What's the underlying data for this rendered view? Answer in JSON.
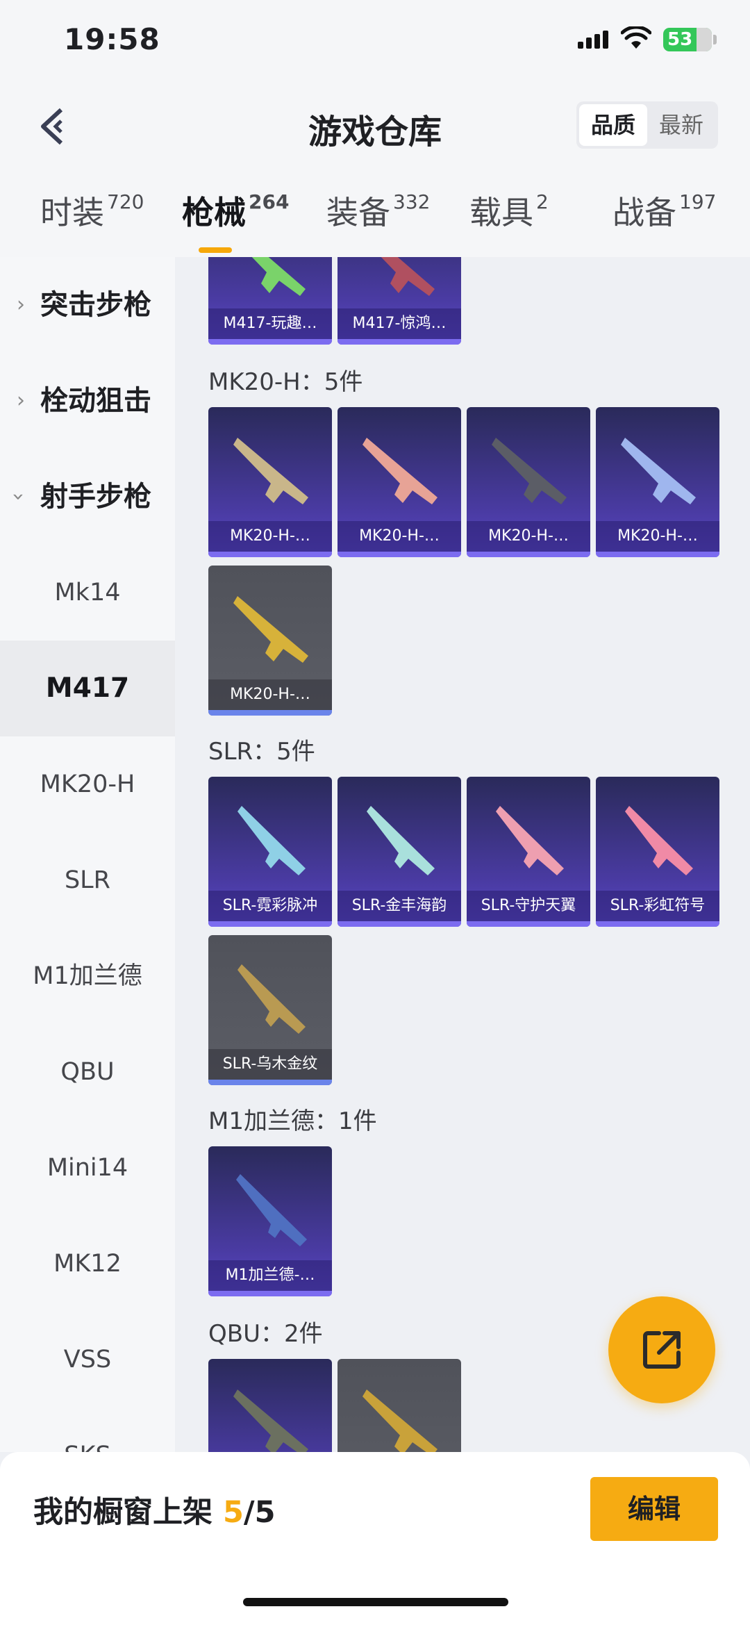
{
  "status": {
    "time": "19:58",
    "battery": "53"
  },
  "header": {
    "title": "游戏仓库",
    "sort_options": [
      {
        "label": "品质",
        "active": true
      },
      {
        "label": "最新",
        "active": false
      }
    ]
  },
  "tabs": [
    {
      "label": "时装",
      "count": "720"
    },
    {
      "label": "枪械",
      "count": "264",
      "active": true
    },
    {
      "label": "装备",
      "count": "332"
    },
    {
      "label": "载具",
      "count": "2"
    },
    {
      "label": "战备",
      "count": "197"
    }
  ],
  "sidebar": {
    "categories": [
      {
        "label": "突击步枪",
        "expanded": false
      },
      {
        "label": "栓动狙击",
        "expanded": false
      },
      {
        "label": "射手步枪",
        "expanded": true
      }
    ],
    "subitems": [
      {
        "label": "Mk14"
      },
      {
        "label": "M417",
        "active": true
      },
      {
        "label": "MK20-H"
      },
      {
        "label": "SLR"
      },
      {
        "label": "M1加兰德"
      },
      {
        "label": "QBU"
      },
      {
        "label": "Mini14"
      },
      {
        "label": "MK12"
      },
      {
        "label": "VSS"
      },
      {
        "label": "SKS"
      }
    ]
  },
  "content": {
    "m417_partial": [
      {
        "label": "M417-玩趣…"
      },
      {
        "label": "M417-惊鸿…"
      }
    ],
    "sections": [
      {
        "title": "MK20-H：5件",
        "items": [
          {
            "label": "MK20-H-…"
          },
          {
            "label": "MK20-H-…"
          },
          {
            "label": "MK20-H-…"
          },
          {
            "label": "MK20-H-…"
          },
          {
            "label": "MK20-H-…"
          }
        ]
      },
      {
        "title": "SLR：5件",
        "items": [
          {
            "label": "SLR-霓彩脉冲"
          },
          {
            "label": "SLR-金丰海韵"
          },
          {
            "label": "SLR-守护天翼"
          },
          {
            "label": "SLR-彩虹符号"
          },
          {
            "label": "SLR-乌木金纹"
          }
        ]
      },
      {
        "title": "M1加兰德：1件",
        "items": [
          {
            "label": "M1加兰德-…"
          }
        ]
      },
      {
        "title": "QBU：2件",
        "items": [
          {
            "label": ""
          },
          {
            "label": ""
          }
        ]
      }
    ]
  },
  "bottom_bar": {
    "text": "我的橱窗上架",
    "current": "5",
    "separator": "/",
    "total": "5",
    "edit_label": "编辑"
  },
  "colors": {
    "accent": "#f6ab12",
    "card_purple": "#4a3ba3",
    "card_gray": "#5c5e66"
  }
}
